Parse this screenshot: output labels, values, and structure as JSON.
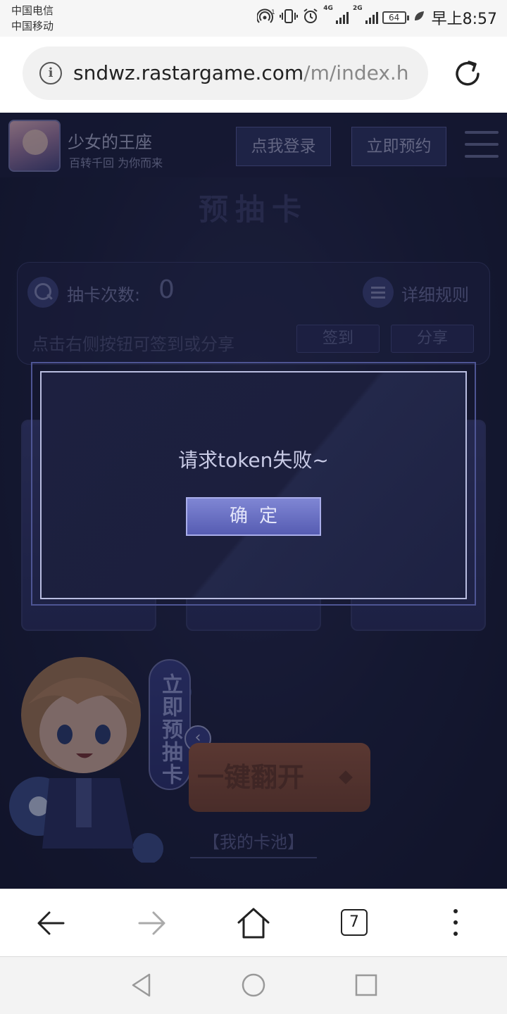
{
  "status_bar": {
    "carrier_1": "中国电信",
    "carrier_2": "中国移动",
    "network_1": "4G",
    "network_2": "2G",
    "battery": "64",
    "time": "早上8:57"
  },
  "browser": {
    "url_host": "sndwz.rastargame.com",
    "url_path": "/m/index.h",
    "tab_count": "7"
  },
  "header": {
    "app_title": "少女的王座",
    "app_slogan": "百转千回 为你而来",
    "login_label": "点我登录",
    "reserve_label": "立即预约"
  },
  "main": {
    "section_title": "预抽卡",
    "draw_count_label": "抽卡次数:",
    "draw_count_value": "0",
    "rules_label": "详细规则",
    "hint": "点击右侧按钮可签到或分享",
    "signin_label": "签到",
    "share_label": "分享",
    "preorder_draw_label": "立即预抽卡",
    "flip_all_label": "一键翻开",
    "my_pool_label": "【我的卡池】"
  },
  "dialog": {
    "message": "请求token失败~",
    "confirm_label": "确定"
  },
  "colors": {
    "page_bg": "#1d2140",
    "dialog_button": "#6a70c4",
    "flip_button": "#8c523b"
  },
  "icons": {
    "info": "info-icon",
    "reload": "reload-icon",
    "back": "back-arrow-icon",
    "forward": "forward-arrow-icon",
    "home": "home-icon",
    "more": "more-vertical-icon"
  }
}
